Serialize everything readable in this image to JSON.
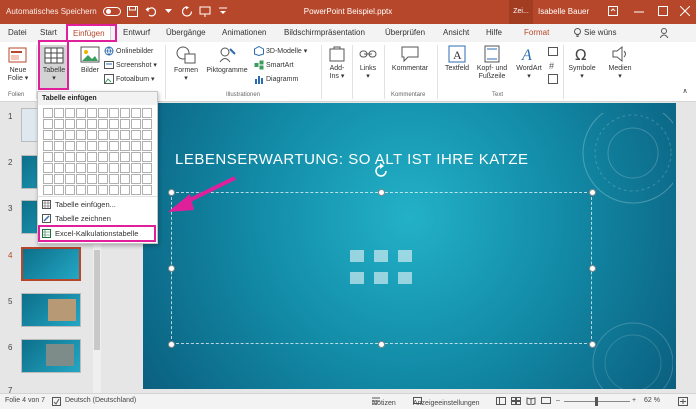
{
  "titlebar": {
    "autosave_label": "Automatisches Speichern",
    "doc_title": "PowerPoint Beispiel.pptx",
    "zei": "Zei...",
    "user": "Isabelle Bauer"
  },
  "tabs": [
    "Datei",
    "Start",
    "Einfügen",
    "Entwurf",
    "Übergänge",
    "Animationen",
    "Bildschirmpräsentation",
    "Überprüfen",
    "Ansicht",
    "Hilfe",
    "Format"
  ],
  "tell_me": "Sie wüns",
  "ribbon": {
    "neue_folie": "Neue\nFolie",
    "neue_folie_1": "Neue",
    "neue_folie_2": "Folie ▾",
    "tabelle": "Tabelle",
    "bilder": "Bilder",
    "onlinebilder": "Onlinebilder",
    "screenshot": "Screenshot ▾",
    "fotoalbum": "Fotoalbum ▾",
    "formen": "Formen",
    "piktogramme": "Piktogramme",
    "modelle": "3D-Modelle ▾",
    "smartart": "SmartArt",
    "diagramm": "Diagramm",
    "addins_1": "Add-",
    "addins_2": "Ins ▾",
    "links": "Links",
    "kommentar": "Kommentar",
    "textfeld": "Textfeld",
    "kopf_1": "Kopf- und",
    "kopf_2": "Fußzeile",
    "wordart": "WordArt",
    "symbole": "Symbole",
    "medien": "Medien",
    "groups": {
      "folien": "Folien",
      "illustrationen": "Illustrationen",
      "kommentare": "Kommentare",
      "text": "Text"
    }
  },
  "dropdown": {
    "title": "Tabelle einfügen",
    "items": [
      "Tabelle einfügen...",
      "Tabelle zeichnen",
      "Excel-Kalkulationstabelle"
    ]
  },
  "slides": [
    "1",
    "2",
    "3",
    "4",
    "5",
    "6",
    "7"
  ],
  "slide": {
    "title": "LEBENSERWARTUNG: SO ALT IST IHRE KATZE"
  },
  "status": {
    "folie": "Folie 4 von 7",
    "sprache": "Deutsch (Deutschland)",
    "notizen": "Notizen",
    "anzeige": "Anzeigeeinstellungen",
    "zoom": "62 %"
  },
  "colors": {
    "accent": "#b7472a",
    "highlight": "#e0209a",
    "slide": "#128aa6"
  }
}
